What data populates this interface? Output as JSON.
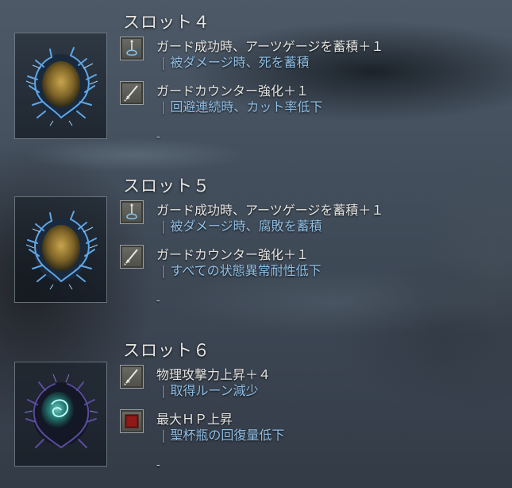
{
  "slots": [
    {
      "title": "スロット４",
      "ash_icon": "blue-coral-gold-ash-icon",
      "effects": [
        {
          "icon": "sorcery-icon",
          "name": "ガード成功時、アーツゲージを蓄積＋１",
          "negative": "被ダメージ時、死を蓄積"
        },
        {
          "icon": "sword-icon",
          "name": "ガードカウンター強化＋１",
          "negative": "回避連続時、カット率低下"
        }
      ],
      "empty_slot": "-"
    },
    {
      "title": "スロット５",
      "ash_icon": "blue-coral-gold-ash-icon",
      "effects": [
        {
          "icon": "sorcery-icon",
          "name": "ガード成功時、アーツゲージを蓄積＋１",
          "negative": "被ダメージ時、腐敗を蓄積"
        },
        {
          "icon": "sword-icon",
          "name": "ガードカウンター強化＋１",
          "negative": "すべての状態異常耐性低下"
        }
      ],
      "empty_slot": "-"
    },
    {
      "title": "スロット６",
      "ash_icon": "dark-teal-swirl-ash-icon",
      "effects": [
        {
          "icon": "sword-icon",
          "name": "物理攻撃力上昇＋４",
          "negative": "取得ルーン減少"
        },
        {
          "icon": "red-hp-icon",
          "name": "最大ＨＰ上昇",
          "negative": "聖杯瓶の回復量低下"
        }
      ],
      "empty_slot": "-"
    }
  ],
  "separator": "|",
  "colors": {
    "title": "#e6e6e3",
    "effect_text": "#e5e5e2",
    "negative_text": "#8fbfe6",
    "hp_icon_red": "#7a1414"
  }
}
